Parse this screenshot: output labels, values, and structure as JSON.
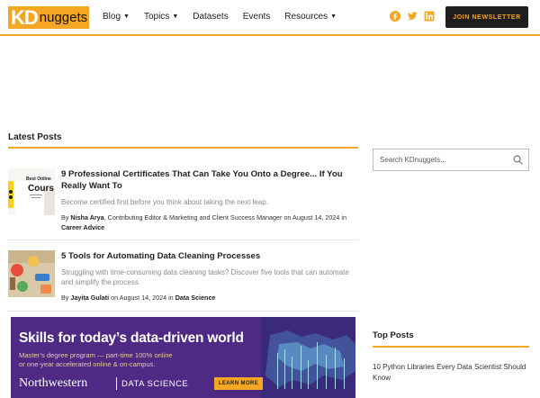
{
  "header": {
    "logo_kd": "KD",
    "logo_nuggets": "nuggets",
    "nav": [
      {
        "label": "Blog",
        "has_caret": true
      },
      {
        "label": "Topics",
        "has_caret": true
      },
      {
        "label": "Datasets",
        "has_caret": false
      },
      {
        "label": "Events",
        "has_caret": false
      },
      {
        "label": "Resources",
        "has_caret": true
      }
    ],
    "social_icons": [
      "facebook-icon",
      "twitter-icon",
      "linkedin-icon"
    ],
    "join_label": "JOIN NEWSLETTER"
  },
  "colors": {
    "accent": "#f5a623",
    "dark": "#1e1e1e",
    "banner": "#4e2a84"
  },
  "latest": {
    "title": "Latest Posts",
    "posts": [
      {
        "title": "9 Professional Certificates That Can Take You Onto a Degree... If You Really Want To",
        "excerpt": "Become certified first before you think about taking the next leap.",
        "by": "By",
        "author": "Nisha Arya",
        "author_role": ", Contributing Editor & Marketing and Client Success Manager on August 14, 2024 in",
        "category": "Career Advice",
        "thumb_text": "Best Online Cours"
      },
      {
        "title": "5 Tools for Automating Data Cleaning Processes",
        "excerpt": "Struggling with time-consuming data cleaning tasks? Discover five tools that can automate and simplify the process.",
        "by": "By",
        "author": "Jayita Gulati",
        "author_role": " on August 14, 2024 in",
        "category": "Data Science"
      }
    ]
  },
  "banner": {
    "headline": "Skills for today’s data-driven world",
    "sub_line1": "Master’s degree program — part-time 100% online",
    "sub_line2": "or one-year accelerated online & on-campus.",
    "brand": "Northwestern",
    "brand_dept": "DATA SCIENCE",
    "cta": "LEARN MORE"
  },
  "sidebar": {
    "search_placeholder": "Search KDnuggets...",
    "top_posts_title": "Top Posts",
    "top_posts": [
      "10 Python Libraries Every Data Scientist Should Know"
    ]
  }
}
